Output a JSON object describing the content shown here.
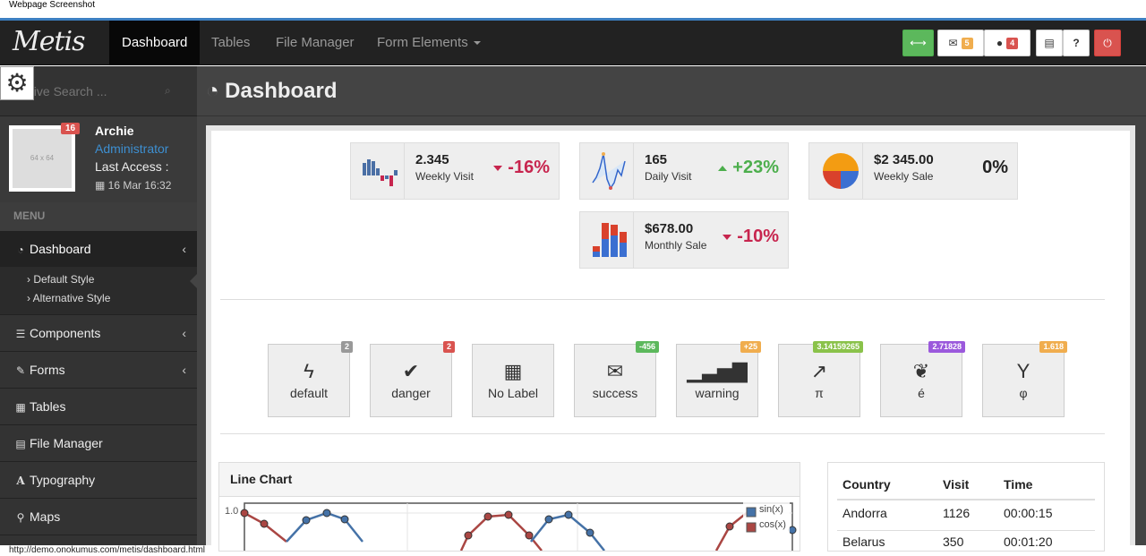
{
  "caption": "Webpage Screenshot",
  "footer_url": "http://demo.onokumus.com/metis/dashboard.html",
  "brand": "Metis",
  "nav": {
    "items": [
      {
        "label": "Dashboard",
        "active": true
      },
      {
        "label": "Tables"
      },
      {
        "label": "File Manager"
      },
      {
        "label": "Form Elements"
      }
    ]
  },
  "toolbar": {
    "mail_count": "5",
    "comment_count": "4"
  },
  "search": {
    "placeholder": "Live Search ..."
  },
  "user": {
    "avatar_text": "64 x 64",
    "badge": "16",
    "name": "Archie",
    "role": "Administrator",
    "last_access_label": "Last Access :",
    "last_access_date": "16 Mar 16:32"
  },
  "menu": {
    "header": "MENU",
    "items": [
      {
        "label": "Dashboard",
        "icon": "dashboard-icon"
      },
      {
        "label": "Components",
        "icon": "list-icon"
      },
      {
        "label": "Forms",
        "icon": "pencil-icon"
      },
      {
        "label": "Tables",
        "icon": "table-icon"
      },
      {
        "label": "File Manager",
        "icon": "file-icon"
      },
      {
        "label": "Typography",
        "icon": "font-icon"
      },
      {
        "label": "Maps",
        "icon": "map-marker-icon"
      }
    ],
    "subitems": [
      "Default Style",
      "Alternative Style"
    ]
  },
  "page_title": "Dashboard",
  "stats": [
    {
      "value": "2.345",
      "label": "Weekly Visit",
      "change": "-16%",
      "direction": "down"
    },
    {
      "value": "165",
      "label": "Daily Visit",
      "change": "+23%",
      "direction": "up"
    },
    {
      "value": "$2 345.00",
      "label": "Weekly Sale",
      "change": "0%",
      "direction": "neutral"
    },
    {
      "value": "$678.00",
      "label": "Monthly Sale",
      "change": "-10%",
      "direction": "down"
    }
  ],
  "quick_buttons": [
    {
      "label": "default",
      "badge": "2",
      "icon": "bolt-icon",
      "badge_color": "#999999"
    },
    {
      "label": "danger",
      "badge": "2",
      "icon": "check-icon",
      "badge_color": "#d9534f"
    },
    {
      "label": "No Label",
      "badge": "",
      "icon": "building-icon",
      "badge_color": ""
    },
    {
      "label": "success",
      "badge": "-456",
      "icon": "envelope-icon",
      "badge_color": "#5cb85c"
    },
    {
      "label": "warning",
      "badge": "+25",
      "icon": "signal-icon",
      "badge_color": "#f0ad4e"
    },
    {
      "label": "π",
      "badge": "3.14159265",
      "icon": "external-link-icon",
      "badge_color": "#8ac24a"
    },
    {
      "label": "é",
      "badge": "2.71828",
      "icon": "leaf-icon",
      "badge_color": "#9b59dc"
    },
    {
      "label": "φ",
      "badge": "1.618",
      "icon": "glass-icon",
      "badge_color": "#f0ad4e"
    }
  ],
  "line_chart": {
    "title": "Line Chart",
    "ytick": "1.0",
    "legend": [
      "sin(x)",
      "cos(x)"
    ],
    "colors": [
      "#4572a7",
      "#aa4643"
    ]
  },
  "table": {
    "headers": [
      "Country",
      "Visit",
      "Time"
    ],
    "rows": [
      [
        "Andorra",
        "1126",
        "00:00:15"
      ],
      [
        "Belarus",
        "350",
        "00:01:20"
      ]
    ]
  }
}
